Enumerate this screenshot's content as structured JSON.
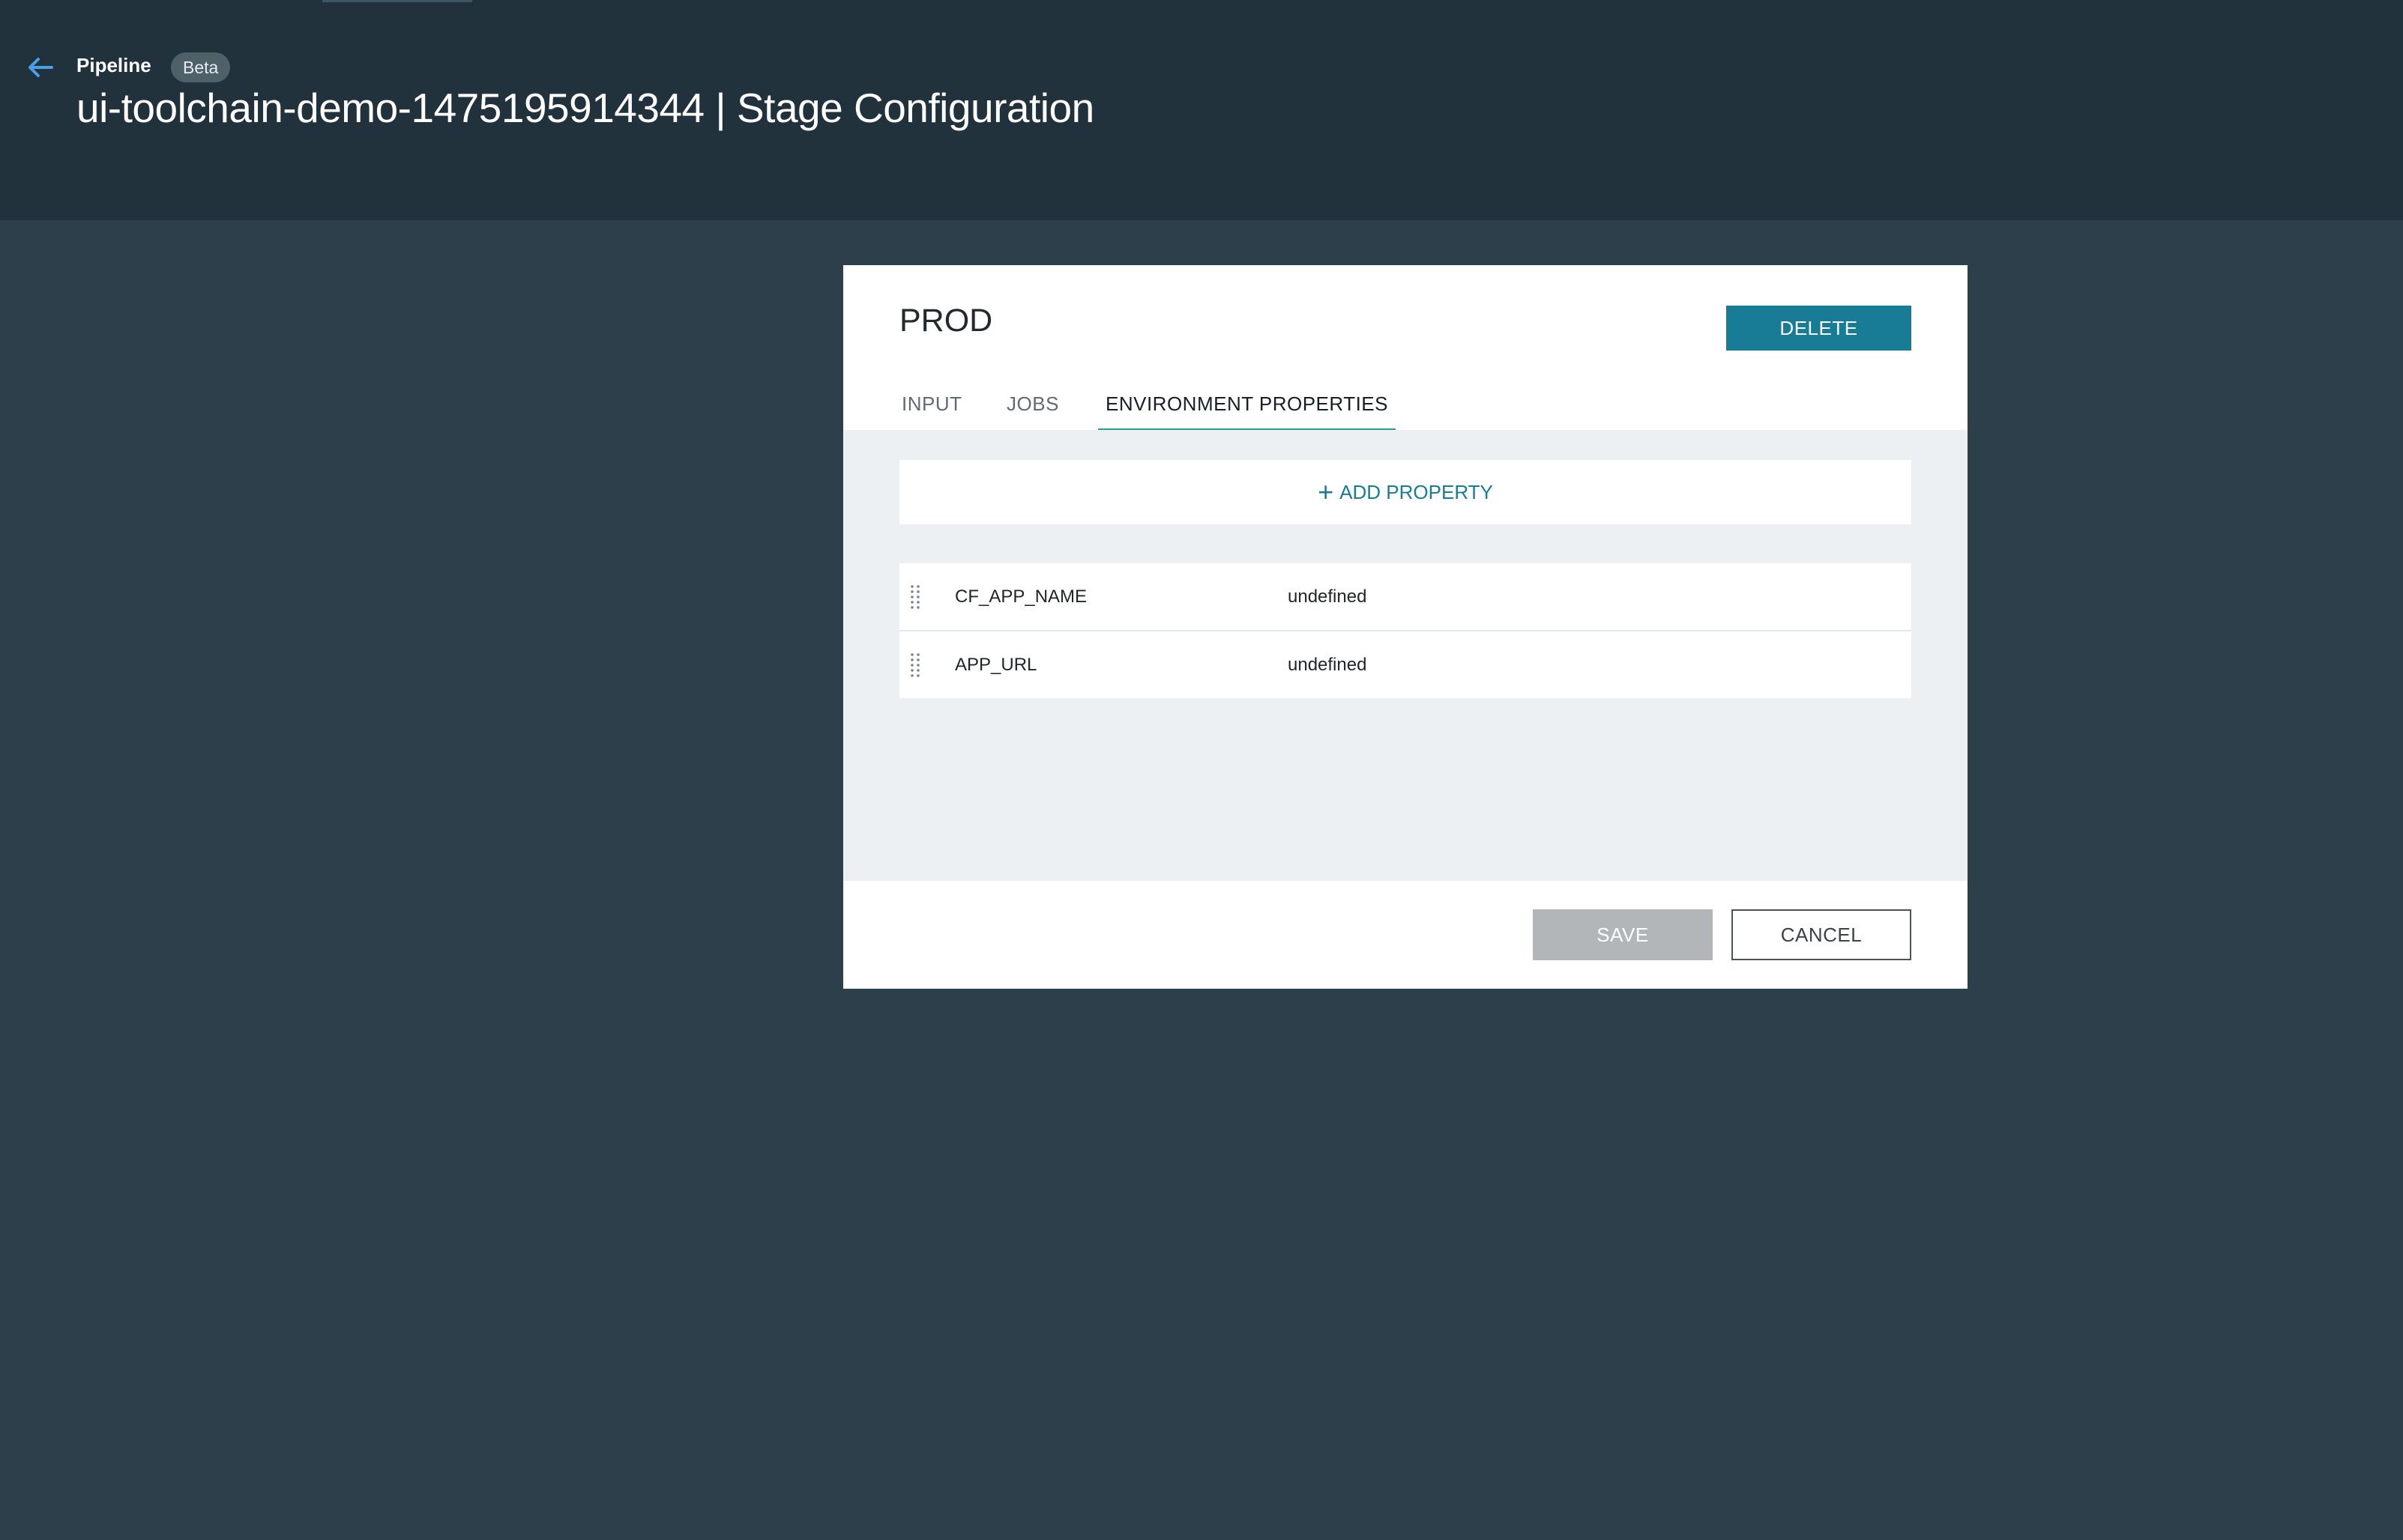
{
  "header": {
    "breadcrumb": "Pipeline",
    "badge": "Beta",
    "title": "ui-toolchain-demo-1475195914344 | Stage Configuration"
  },
  "modal": {
    "stage_name": "PROD",
    "delete_label": "DELETE",
    "tabs": [
      {
        "label": "INPUT",
        "active": false
      },
      {
        "label": "JOBS",
        "active": false
      },
      {
        "label": "ENVIRONMENT PROPERTIES",
        "active": true
      }
    ],
    "add_property_label": "ADD PROPERTY",
    "properties": [
      {
        "key": "CF_APP_NAME",
        "value": "undefined"
      },
      {
        "key": "APP_URL",
        "value": "undefined"
      }
    ],
    "save_label": "SAVE",
    "cancel_label": "CANCEL"
  },
  "icons": {
    "back": "arrow-left-icon",
    "add": "plus-icon",
    "drag": "drag-handle-icon"
  },
  "colors": {
    "accent": "#197c97",
    "tab_underline": "#2a9d8f",
    "header_bg": "#22323c",
    "page_bg": "#2c3f4a"
  }
}
